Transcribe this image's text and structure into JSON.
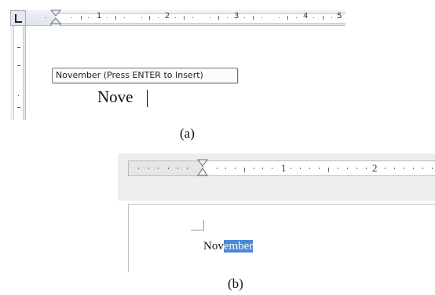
{
  "panel_a": {
    "ruler_numbers": [
      "1",
      "2",
      "3",
      "4",
      "5"
    ],
    "autocomplete_tooltip": "November  (Press ENTER to Insert)",
    "typed_text": "Nove",
    "caption": "(a)"
  },
  "panel_b": {
    "ruler_numbers": [
      "1",
      "2"
    ],
    "typed_text": "Nov",
    "suggested_completion": "ember",
    "caption": "(b)"
  },
  "colors": {
    "selection_highlight": "#4a88d4",
    "ruler_background": "#dfe4ec",
    "tooltip_border": "#767676"
  }
}
